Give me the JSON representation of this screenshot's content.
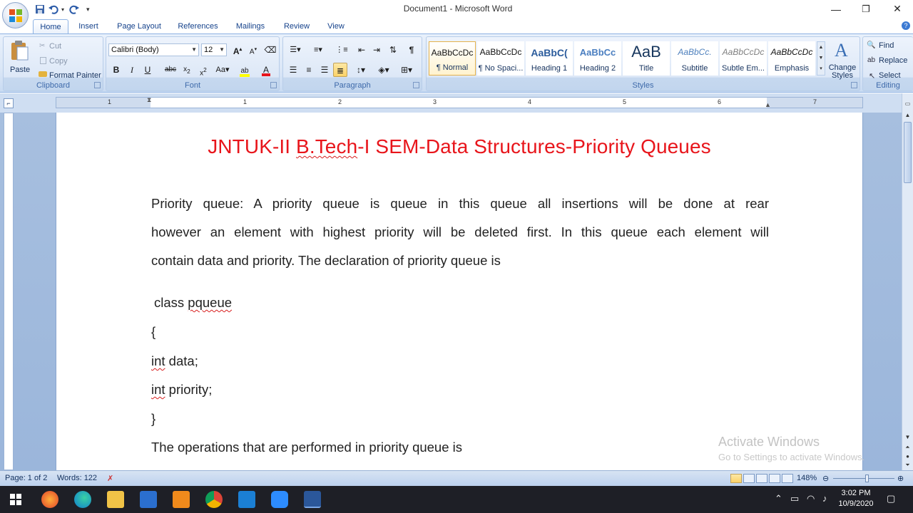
{
  "window": {
    "title": "Document1 - Microsoft Word",
    "minimize": "—",
    "restore": "❐",
    "close": "✕"
  },
  "tabs": [
    "Home",
    "Insert",
    "Page Layout",
    "References",
    "Mailings",
    "Review",
    "View"
  ],
  "active_tab": "Home",
  "clipboard": {
    "paste": "Paste",
    "cut": "Cut",
    "copy": "Copy",
    "format_painter": "Format Painter",
    "label": "Clipboard"
  },
  "font": {
    "name": "Calibri (Body)",
    "size": "12",
    "label": "Font"
  },
  "paragraph": {
    "label": "Paragraph"
  },
  "styles": {
    "label": "Styles",
    "change_styles": "Change Styles",
    "items": [
      {
        "sample": "AaBbCcDc",
        "name": "¶ Normal"
      },
      {
        "sample": "AaBbCcDc",
        "name": "¶ No Spaci..."
      },
      {
        "sample": "AaBbC(",
        "name": "Heading 1"
      },
      {
        "sample": "AaBbCc",
        "name": "Heading 2"
      },
      {
        "sample": "AaB",
        "name": "Title"
      },
      {
        "sample": "AaBbCc.",
        "name": "Subtitle"
      },
      {
        "sample": "AaBbCcDc",
        "name": "Subtle Em..."
      },
      {
        "sample": "AaBbCcDc",
        "name": "Emphasis"
      }
    ]
  },
  "editing": {
    "find": "Find",
    "replace": "Replace",
    "select": "Select",
    "label": "Editing"
  },
  "ruler_numbers": [
    "1",
    "1",
    "2",
    "3",
    "4",
    "5",
    "6",
    "7"
  ],
  "document": {
    "heading_parts": [
      "JNTUK-II ",
      "B.Tech",
      "-I SEM-Data Structures-Priority Queues"
    ],
    "para_lines": [
      "Priority queue: A priority queue is queue in this queue all insertions will be done at rear",
      "however an element with highest priority will be deleted first. In this queue each element will",
      "contain data and priority. The declaration of priority queue is"
    ],
    "code": {
      "class_kw": "class ",
      "class_name": "pqueue",
      "open_brace": "{",
      "int1": "int",
      "field1": " data;",
      "int2": "int",
      "field2": " priority;",
      "close_brace": "}"
    },
    "ops_line": "The operations that are performed in priority queue is"
  },
  "watermark": {
    "line1": "Activate Windows",
    "line2": "Go to Settings to activate Windows."
  },
  "status": {
    "page": "Page: 1 of 2",
    "words": "Words: 122",
    "zoom": "148%"
  },
  "clock": {
    "time": "3:02 PM",
    "date": "10/9/2020"
  },
  "colors": {
    "heading": "#e8151b",
    "ribbon": "#dbe7f7",
    "taskbar": "#1e1f26"
  }
}
